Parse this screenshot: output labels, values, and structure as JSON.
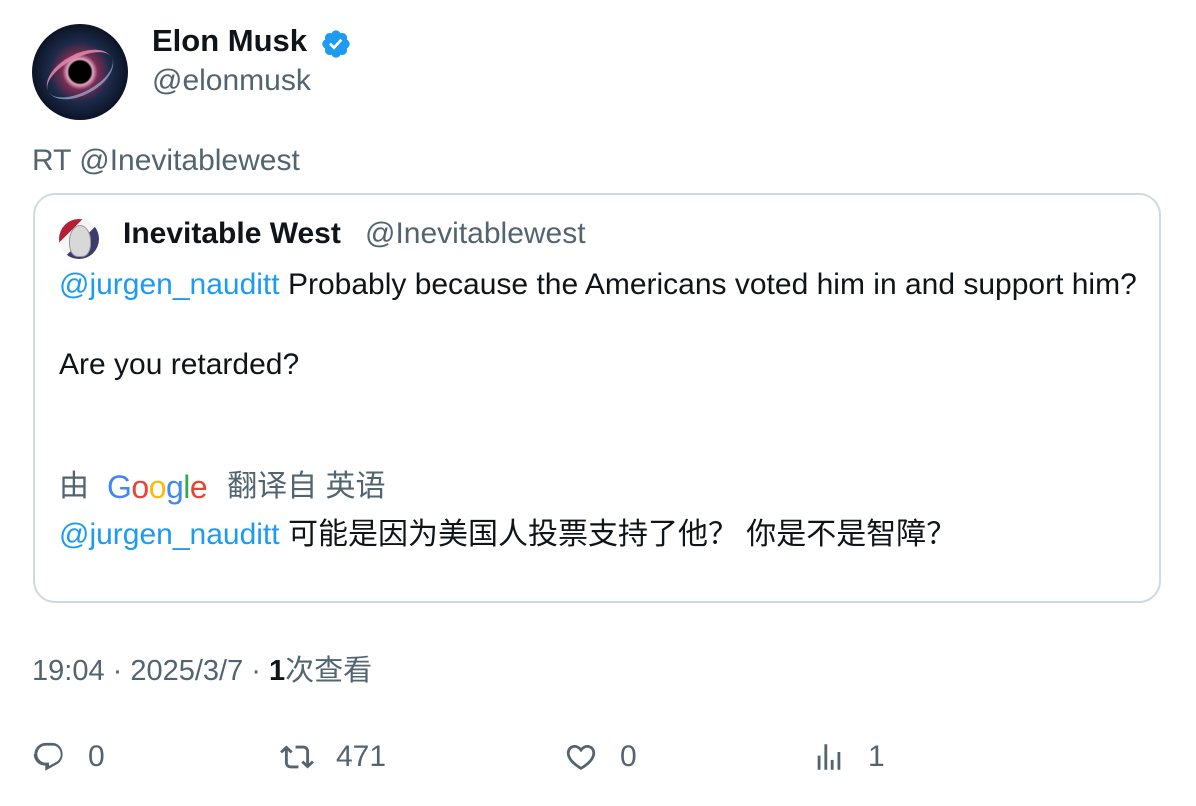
{
  "author": {
    "name": "Elon Musk",
    "handle": "@elonmusk",
    "verified_icon": "verified-badge-icon"
  },
  "retweet_prefix": "RT @Inevitablewest",
  "quoted": {
    "name": "Inevitable West",
    "handle": "@Inevitablewest",
    "mention": "@jurgen_nauditt",
    "text_line1": "Probably because the Americans voted him in and support him?",
    "text_line2": "Are you retarded?",
    "translate_by": "由",
    "translate_brand": "Google",
    "translate_from": "翻译自 英语",
    "translated_mention": "@jurgen_nauditt",
    "translated_text": "可能是因为美国人投票支持了他？ 你是不是智障？"
  },
  "meta": {
    "time": "19:04",
    "date": "2025/3/7",
    "views_count": "1",
    "views_label": "次查看"
  },
  "actions": {
    "replies": "0",
    "retweets": "471",
    "likes": "0",
    "views": "1"
  },
  "colors": {
    "link": "#1d9bf0",
    "muted": "#536471",
    "text": "#0f1419",
    "border": "#cfd9de"
  }
}
